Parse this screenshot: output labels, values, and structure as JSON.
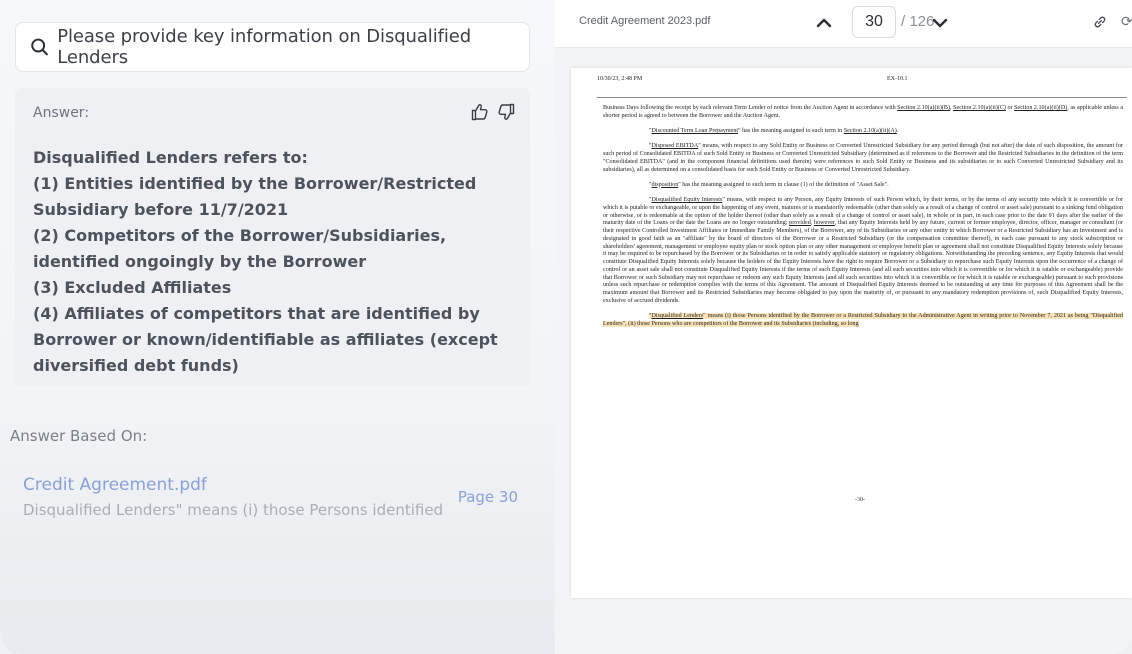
{
  "search": {
    "query": "Please provide key information on Disqualified Lenders"
  },
  "answer": {
    "label": "Answer:",
    "lines": [
      "Disqualified Lenders refers to:",
      "(1) Entities identified by the Borrower/Restricted Subsidiary before 11/7/2021",
      "(2) Competitors of the Borrower/Subsidiaries, identified ongoingly by the Borrower",
      "(3) Excluded Affiliates",
      "(4) Affiliates of competitors that are identified by Borrower or known/identifiable as affiliates (except diversified debt funds)"
    ]
  },
  "based_on": {
    "label": "Answer Based On:",
    "source_title": "Credit Agreement.pdf",
    "snippet": "Disqualified Lenders\" means (i) those Persons identified",
    "page": "Page 30"
  },
  "viewer": {
    "file_name": "Credit Agreement 2023.pdf",
    "current_page": "30",
    "total_pages": "/ 126"
  },
  "pdf": {
    "header_left": "10/30/23, 2:48 PM",
    "header_center": "EX-10.1",
    "page_number": "-30-"
  },
  "colors": {
    "accent": "#8b9fd8",
    "highlight": "#fbe3b9"
  }
}
